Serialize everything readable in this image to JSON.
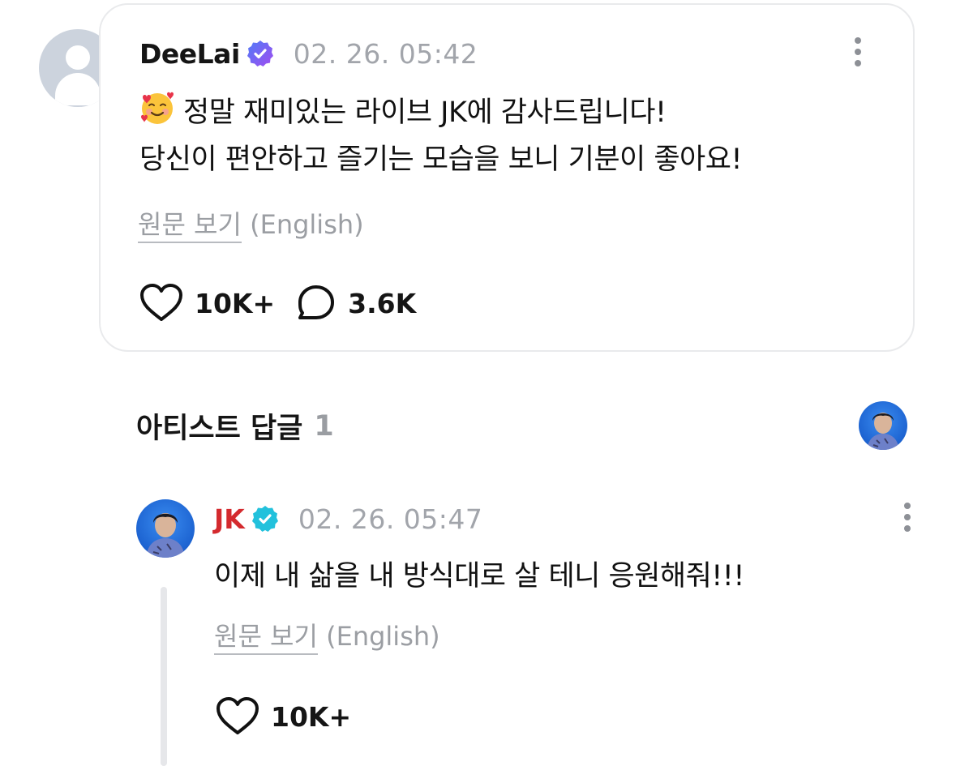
{
  "comment": {
    "author": "DeeLai",
    "timestamp": "02. 26. 05:42",
    "emoji_name": "smiling-face-with-hearts",
    "text_line1": "정말 재미있는 라이브 JK에 감사드립니다!",
    "text_line2": "당신이 편안하고 즐기는 모습을 보니 기분이 좋아요!",
    "translate_link": "원문 보기",
    "translate_lang": "(English)",
    "likes": "10K+",
    "replies": "3.6K"
  },
  "artist_replies": {
    "label": "아티스트 답글",
    "count": "1"
  },
  "reply": {
    "author": "JK",
    "timestamp": "02. 26. 05:47",
    "text": "이제 내 삶을 내 방식대로 살 테니 응원해줘!!!",
    "translate_link": "원문 보기",
    "translate_lang": "(English)",
    "likes": "10K+"
  },
  "colors": {
    "fan_badge": "#7b5cf0",
    "artist_badge": "#22c1dc",
    "artist_name": "#d42a2e"
  }
}
